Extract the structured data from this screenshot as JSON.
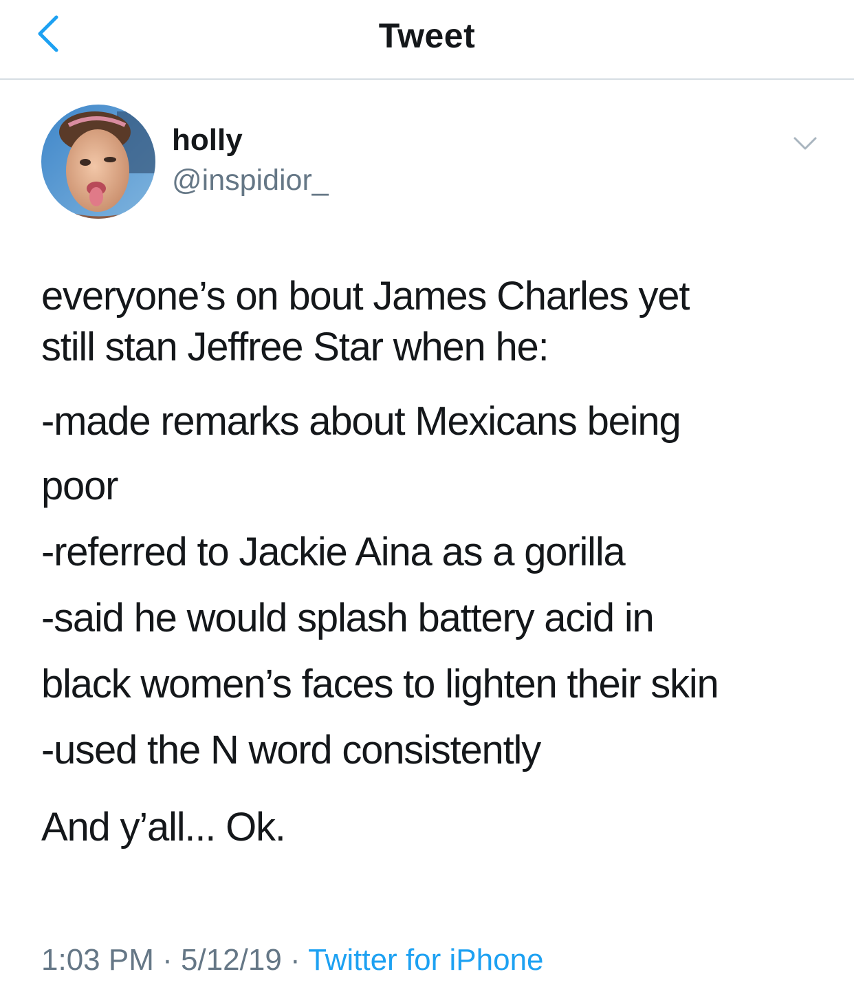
{
  "nav": {
    "title": "Tweet",
    "back_icon": "chevron-left-icon",
    "accent_color": "#1da1f2"
  },
  "author": {
    "name": "holly",
    "handle": "@inspidior_",
    "avatar_icon": "profile-photo"
  },
  "tweet": {
    "paragraphs": [
      [
        "everyone’s on bout James Charles yet",
        "still stan Jeffree Star when he:"
      ],
      [
        "-made remarks about Mexicans being",
        "poor",
        "-referred to Jackie Aina as a gorilla",
        "-said he would splash battery acid in",
        "black women’s faces to lighten their skin",
        "-used the N word consistently"
      ],
      [
        "And y’all... Ok."
      ]
    ],
    "time": "1:03 PM",
    "date": "5/12/19",
    "separator": "·",
    "source": "Twitter for iPhone"
  },
  "colors": {
    "text": "#14171a",
    "secondary": "#657786",
    "divider": "#d6dde3",
    "link": "#1da1f2"
  }
}
